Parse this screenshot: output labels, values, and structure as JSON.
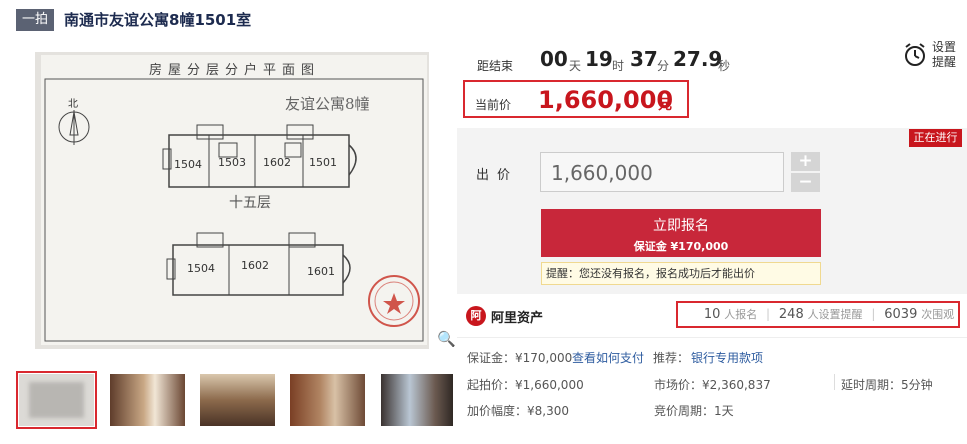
{
  "header": {
    "tag": "一拍",
    "title": "南通市友谊公寓8幢1501室"
  },
  "plan": {
    "heading": "房屋分层分户平面图",
    "name": "友谊公寓8幢",
    "north": "北",
    "floor": "十五层",
    "rooms_top": [
      "1504",
      "1503",
      "1602",
      "1501"
    ],
    "rooms_bottom": [
      "1504",
      "1602",
      "1601"
    ]
  },
  "countdown": {
    "label": "距结束",
    "days": "00",
    "days_unit": "天",
    "hours": "19",
    "hours_unit": "时",
    "minutes": "37",
    "minutes_unit": "分",
    "seconds": "27.9",
    "seconds_unit": "秒"
  },
  "reminder": {
    "label": "设置提醒"
  },
  "current": {
    "label": "当前价",
    "price": "1,660,000",
    "unit": "元"
  },
  "status": "正在进行",
  "bid": {
    "label": "出价",
    "value": "1,660,000",
    "plus": "+",
    "minus": "−",
    "signup_label": "立即报名",
    "deposit_label": "保证金 ¥170,000",
    "tip": "提醒：您还没有报名，报名成功后才能出价"
  },
  "brand": {
    "logo": "阿",
    "name": "阿里资产"
  },
  "stats": [
    {
      "value": "10",
      "unit": "人报名"
    },
    {
      "value": "248",
      "unit": "人设置提醒"
    },
    {
      "value": "6039",
      "unit": "次围观"
    }
  ],
  "info": {
    "deposit": "保证金：¥170,000",
    "howto_link": "查看如何支付",
    "recommend_label": "推荐：",
    "recommend_link": "银行专用款项",
    "start_price": "起拍价：¥1,660,000",
    "market_price": "市场价：¥2,360,837",
    "delay": "延时周期：5分钟",
    "increment": "加价幅度：¥8,300",
    "bid_period": "竞价周期：1天"
  },
  "thumbnails": [
    "thumb-floorplan",
    "thumb-hallway",
    "thumb-living-room",
    "thumb-dining-room",
    "thumb-bedroom"
  ]
}
